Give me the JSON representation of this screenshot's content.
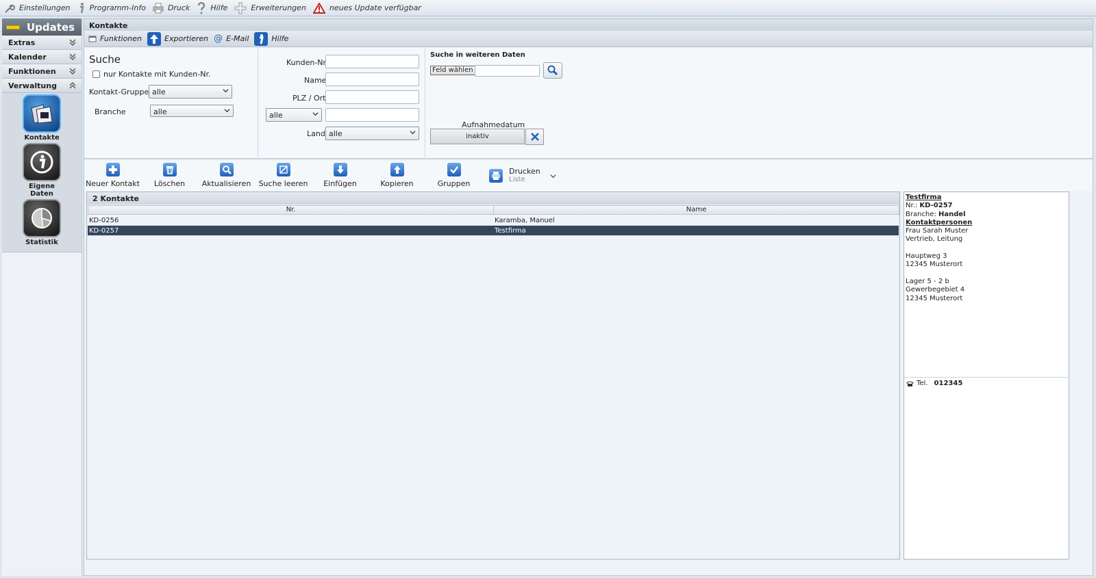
{
  "topmenu": {
    "items": [
      {
        "label": "Einstellungen",
        "icon": "wrench-icon"
      },
      {
        "label": "Programm-Info",
        "icon": "info-icon"
      },
      {
        "label": "Druck",
        "icon": "printer-icon"
      },
      {
        "label": "Hilfe",
        "icon": "question-icon"
      },
      {
        "label": "Erweiterungen",
        "icon": "plus-icon"
      },
      {
        "label": "neues Update verfügbar",
        "icon": "warning-icon"
      }
    ]
  },
  "sidebar": {
    "updates_label": "Updates",
    "sections": [
      "Extras",
      "Kalender",
      "Funktionen",
      "Verwaltung"
    ],
    "nav": [
      {
        "label": "Kontakte",
        "icon": "contacts-icon"
      },
      {
        "label": "Eigene Daten",
        "icon": "info-circle-icon"
      },
      {
        "label": "Statistik",
        "icon": "pie-chart-icon"
      }
    ]
  },
  "main": {
    "title": "Kontakte",
    "subtools": [
      {
        "label": "Funktionen",
        "icon": "window-icon"
      },
      {
        "label": "Exportieren",
        "icon": "export-arrow-icon"
      },
      {
        "label": "E-Mail",
        "icon": "at-icon"
      },
      {
        "label": "Hilfe",
        "icon": "info-icon"
      }
    ]
  },
  "search": {
    "heading": "Suche",
    "only_with_number_label": "nur Kontakte mit Kunden-Nr.",
    "group_label": "Kontakt-Gruppe",
    "group_value": "alle",
    "branch_label": "Branche",
    "branch_value": "alle",
    "customer_no_label": "Kunden-Nr.",
    "name_label": "Name",
    "zip_city_label": "PLZ / Ort",
    "extra_select_value": "alle",
    "country_label": "Land",
    "country_value": "alle",
    "more_heading": "Suche in weiteren Daten",
    "field_choose_label": "Feld wählen",
    "date_label": "Aufnahmedatum",
    "date_value": "inaktiv"
  },
  "actions": [
    {
      "label": "Neuer Kontakt",
      "icon": "add-icon"
    },
    {
      "label": "Löschen",
      "icon": "trash-icon"
    },
    {
      "label": "Aktualisieren",
      "icon": "refresh-search-icon"
    },
    {
      "label": "Suche leeren",
      "icon": "clear-search-icon"
    },
    {
      "label": "Einfügen",
      "icon": "arrow-down-icon"
    },
    {
      "label": "Kopieren",
      "icon": "arrow-up-icon"
    },
    {
      "label": "Gruppen",
      "icon": "check-icon"
    }
  ],
  "print": {
    "label": "Drucken",
    "sub": "Liste"
  },
  "list": {
    "heading": "2 Kontakte",
    "columns": [
      "Nr.",
      "Name"
    ],
    "rows": [
      {
        "nr": "KD-0256",
        "name": "Karamba, Manuel"
      },
      {
        "nr": "KD-0257",
        "name": "Testfirma"
      }
    ]
  },
  "detail": {
    "company": "Testfirma",
    "nr_label": "Nr.: ",
    "nr": "KD-0257",
    "branch_label": "Branche: ",
    "branch": "Handel",
    "contacts_heading": "Kontaktpersonen",
    "person": "Frau Sarah Muster",
    "role": "Vertrieb, Leitung",
    "addr1_street": "Hauptweg 3",
    "addr1_city": "12345 Musterort",
    "addr2_line1": "Lager 5 - 2 b",
    "addr2_street": "Gewerbegebiet 4",
    "addr2_city": "12345 Musterort",
    "tel_label": "Tel.",
    "tel": "012345"
  }
}
